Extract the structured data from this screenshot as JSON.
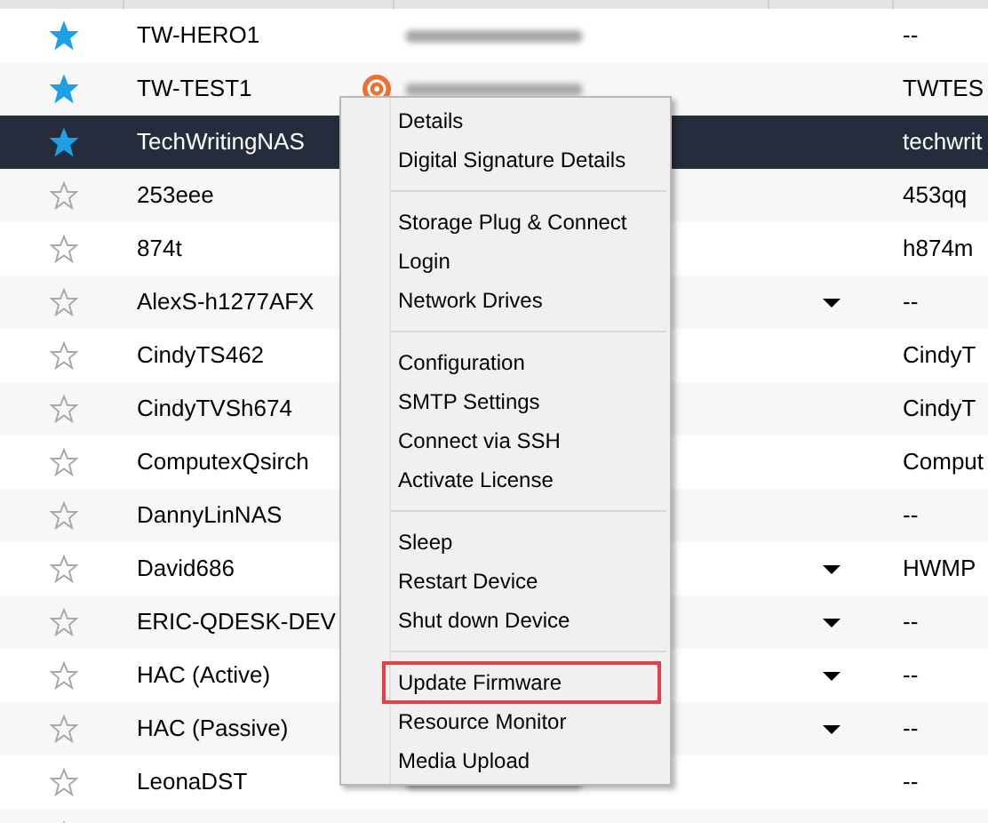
{
  "rows": [
    {
      "starred": true,
      "selected": false,
      "name": "TW-HERO1",
      "badge": false,
      "ip_blurred": true,
      "dropdown": false,
      "column_5": "--"
    },
    {
      "starred": true,
      "selected": false,
      "name": "TW-TEST1",
      "badge": true,
      "ip_blurred": true,
      "dropdown": false,
      "column_5": "TWTES"
    },
    {
      "starred": true,
      "selected": true,
      "name": "TechWritingNAS",
      "badge": false,
      "ip_blurred": false,
      "dropdown": false,
      "column_5": "techwrit"
    },
    {
      "starred": false,
      "selected": false,
      "name": "253eee",
      "badge": false,
      "ip_blurred": false,
      "dropdown": false,
      "column_5": "453qq"
    },
    {
      "starred": false,
      "selected": false,
      "name": "874t",
      "badge": false,
      "ip_blurred": false,
      "dropdown": false,
      "column_5": "h874m"
    },
    {
      "starred": false,
      "selected": false,
      "name": "AlexS-h1277AFX",
      "badge": false,
      "ip_blurred": false,
      "dropdown": true,
      "column_5": "--"
    },
    {
      "starred": false,
      "selected": false,
      "name": "CindyTS462",
      "badge": false,
      "ip_blurred": false,
      "dropdown": false,
      "column_5": "CindyT"
    },
    {
      "starred": false,
      "selected": false,
      "name": "CindyTVSh674",
      "badge": false,
      "ip_blurred": false,
      "dropdown": false,
      "column_5": "CindyT"
    },
    {
      "starred": false,
      "selected": false,
      "name": "ComputexQsirch",
      "badge": false,
      "ip_blurred": false,
      "dropdown": false,
      "column_5": "Comput"
    },
    {
      "starred": false,
      "selected": false,
      "name": "DannyLinNAS",
      "badge": false,
      "ip_blurred": false,
      "dropdown": false,
      "column_5": "--"
    },
    {
      "starred": false,
      "selected": false,
      "name": "David686",
      "badge": false,
      "ip_blurred": false,
      "dropdown": true,
      "column_5": "HWMP"
    },
    {
      "starred": false,
      "selected": false,
      "name": "ERIC-QDESK-DEV",
      "badge": false,
      "ip_blurred": false,
      "dropdown": true,
      "column_5": "--"
    },
    {
      "starred": false,
      "selected": false,
      "name": "HAC (Active)",
      "badge": false,
      "ip_blurred": false,
      "dropdown": true,
      "column_5": "--"
    },
    {
      "starred": false,
      "selected": false,
      "name": "HAC (Passive)",
      "badge": false,
      "ip_blurred": false,
      "dropdown": true,
      "column_5": "--"
    },
    {
      "starred": false,
      "selected": false,
      "name": "LeonaDST",
      "badge": false,
      "ip_blurred": true,
      "dropdown": false,
      "column_5": "--"
    },
    {
      "starred": false,
      "selected": false,
      "badge": false,
      "ip_blurred": false,
      "dropdown": false
    }
  ],
  "context_menu": {
    "groups": [
      [
        {
          "label": "Details",
          "outlined": false
        },
        {
          "label": "Digital Signature Details",
          "outlined": false
        }
      ],
      [
        {
          "label": "Storage Plug & Connect",
          "outlined": false
        },
        {
          "label": "Login",
          "outlined": false
        },
        {
          "label": "Network Drives",
          "outlined": false
        }
      ],
      [
        {
          "label": "Configuration",
          "outlined": false
        },
        {
          "label": "SMTP Settings",
          "outlined": false
        },
        {
          "label": "Connect via SSH",
          "outlined": false
        },
        {
          "label": "Activate License",
          "outlined": false
        }
      ],
      [
        {
          "label": "Sleep",
          "outlined": false
        },
        {
          "label": "Restart Device",
          "outlined": false
        },
        {
          "label": "Shut down Device",
          "outlined": false
        }
      ],
      [
        {
          "label": "Update Firmware",
          "outlined": true
        },
        {
          "label": "Resource Monitor",
          "outlined": false
        },
        {
          "label": "Media Upload",
          "outlined": false
        }
      ]
    ]
  }
}
